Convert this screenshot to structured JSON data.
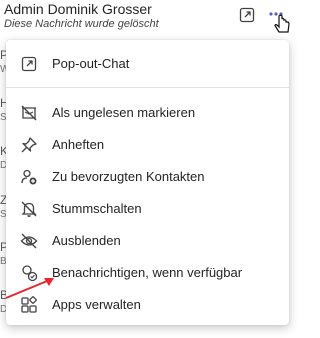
{
  "chat": {
    "name": "Admin Dominik Grosser",
    "preview": "Diese Nachricht wurde gelöscht"
  },
  "background_list": {
    "letters": [
      "P",
      "W",
      "H",
      "S",
      "K",
      "D",
      "Z",
      "S",
      "P",
      "B",
      "B",
      "D"
    ]
  },
  "menu": {
    "items": [
      {
        "label": "Pop-out-Chat",
        "icon": "popout-icon"
      },
      {
        "label": "Als ungelesen markieren",
        "icon": "unread-icon"
      },
      {
        "label": "Anheften",
        "icon": "pin-icon"
      },
      {
        "label": "Zu bevorzugten Kontakten",
        "icon": "favorite-contact-icon"
      },
      {
        "label": "Stummschalten",
        "icon": "mute-icon"
      },
      {
        "label": "Ausblenden",
        "icon": "hide-icon"
      },
      {
        "label": "Benachrichtigen, wenn verfügbar",
        "icon": "notify-available-icon"
      },
      {
        "label": "Apps verwalten",
        "icon": "apps-icon"
      }
    ]
  },
  "colors": {
    "icon_stroke": "#424242",
    "more_button_accent": "#5b5fc7",
    "annotation_arrow": "#e8262d"
  }
}
